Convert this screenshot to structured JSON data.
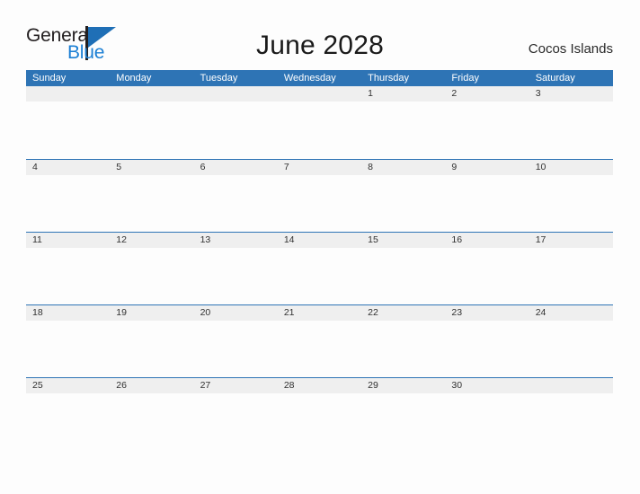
{
  "brand": {
    "name_part1": "General",
    "name_part2": "Blue",
    "logo_icon": "sail-triangle-icon",
    "accent_color": "#1f6fb6",
    "blue_text_color": "#1b7fd4"
  },
  "header": {
    "title": "June 2028",
    "location": "Cocos Islands"
  },
  "calendar": {
    "month": "June",
    "year": "2028",
    "header_bg_color": "#2e74b5",
    "date_band_color": "#efefef",
    "row_divider_color": "#2e74b5",
    "weekdays": [
      "Sunday",
      "Monday",
      "Tuesday",
      "Wednesday",
      "Thursday",
      "Friday",
      "Saturday"
    ],
    "weeks": [
      {
        "days": [
          "",
          "",
          "",
          "",
          "1",
          "2",
          "3"
        ]
      },
      {
        "days": [
          "4",
          "5",
          "6",
          "7",
          "8",
          "9",
          "10"
        ]
      },
      {
        "days": [
          "11",
          "12",
          "13",
          "14",
          "15",
          "16",
          "17"
        ]
      },
      {
        "days": [
          "18",
          "19",
          "20",
          "21",
          "22",
          "23",
          "24"
        ]
      },
      {
        "days": [
          "25",
          "26",
          "27",
          "28",
          "29",
          "30",
          ""
        ]
      }
    ]
  }
}
